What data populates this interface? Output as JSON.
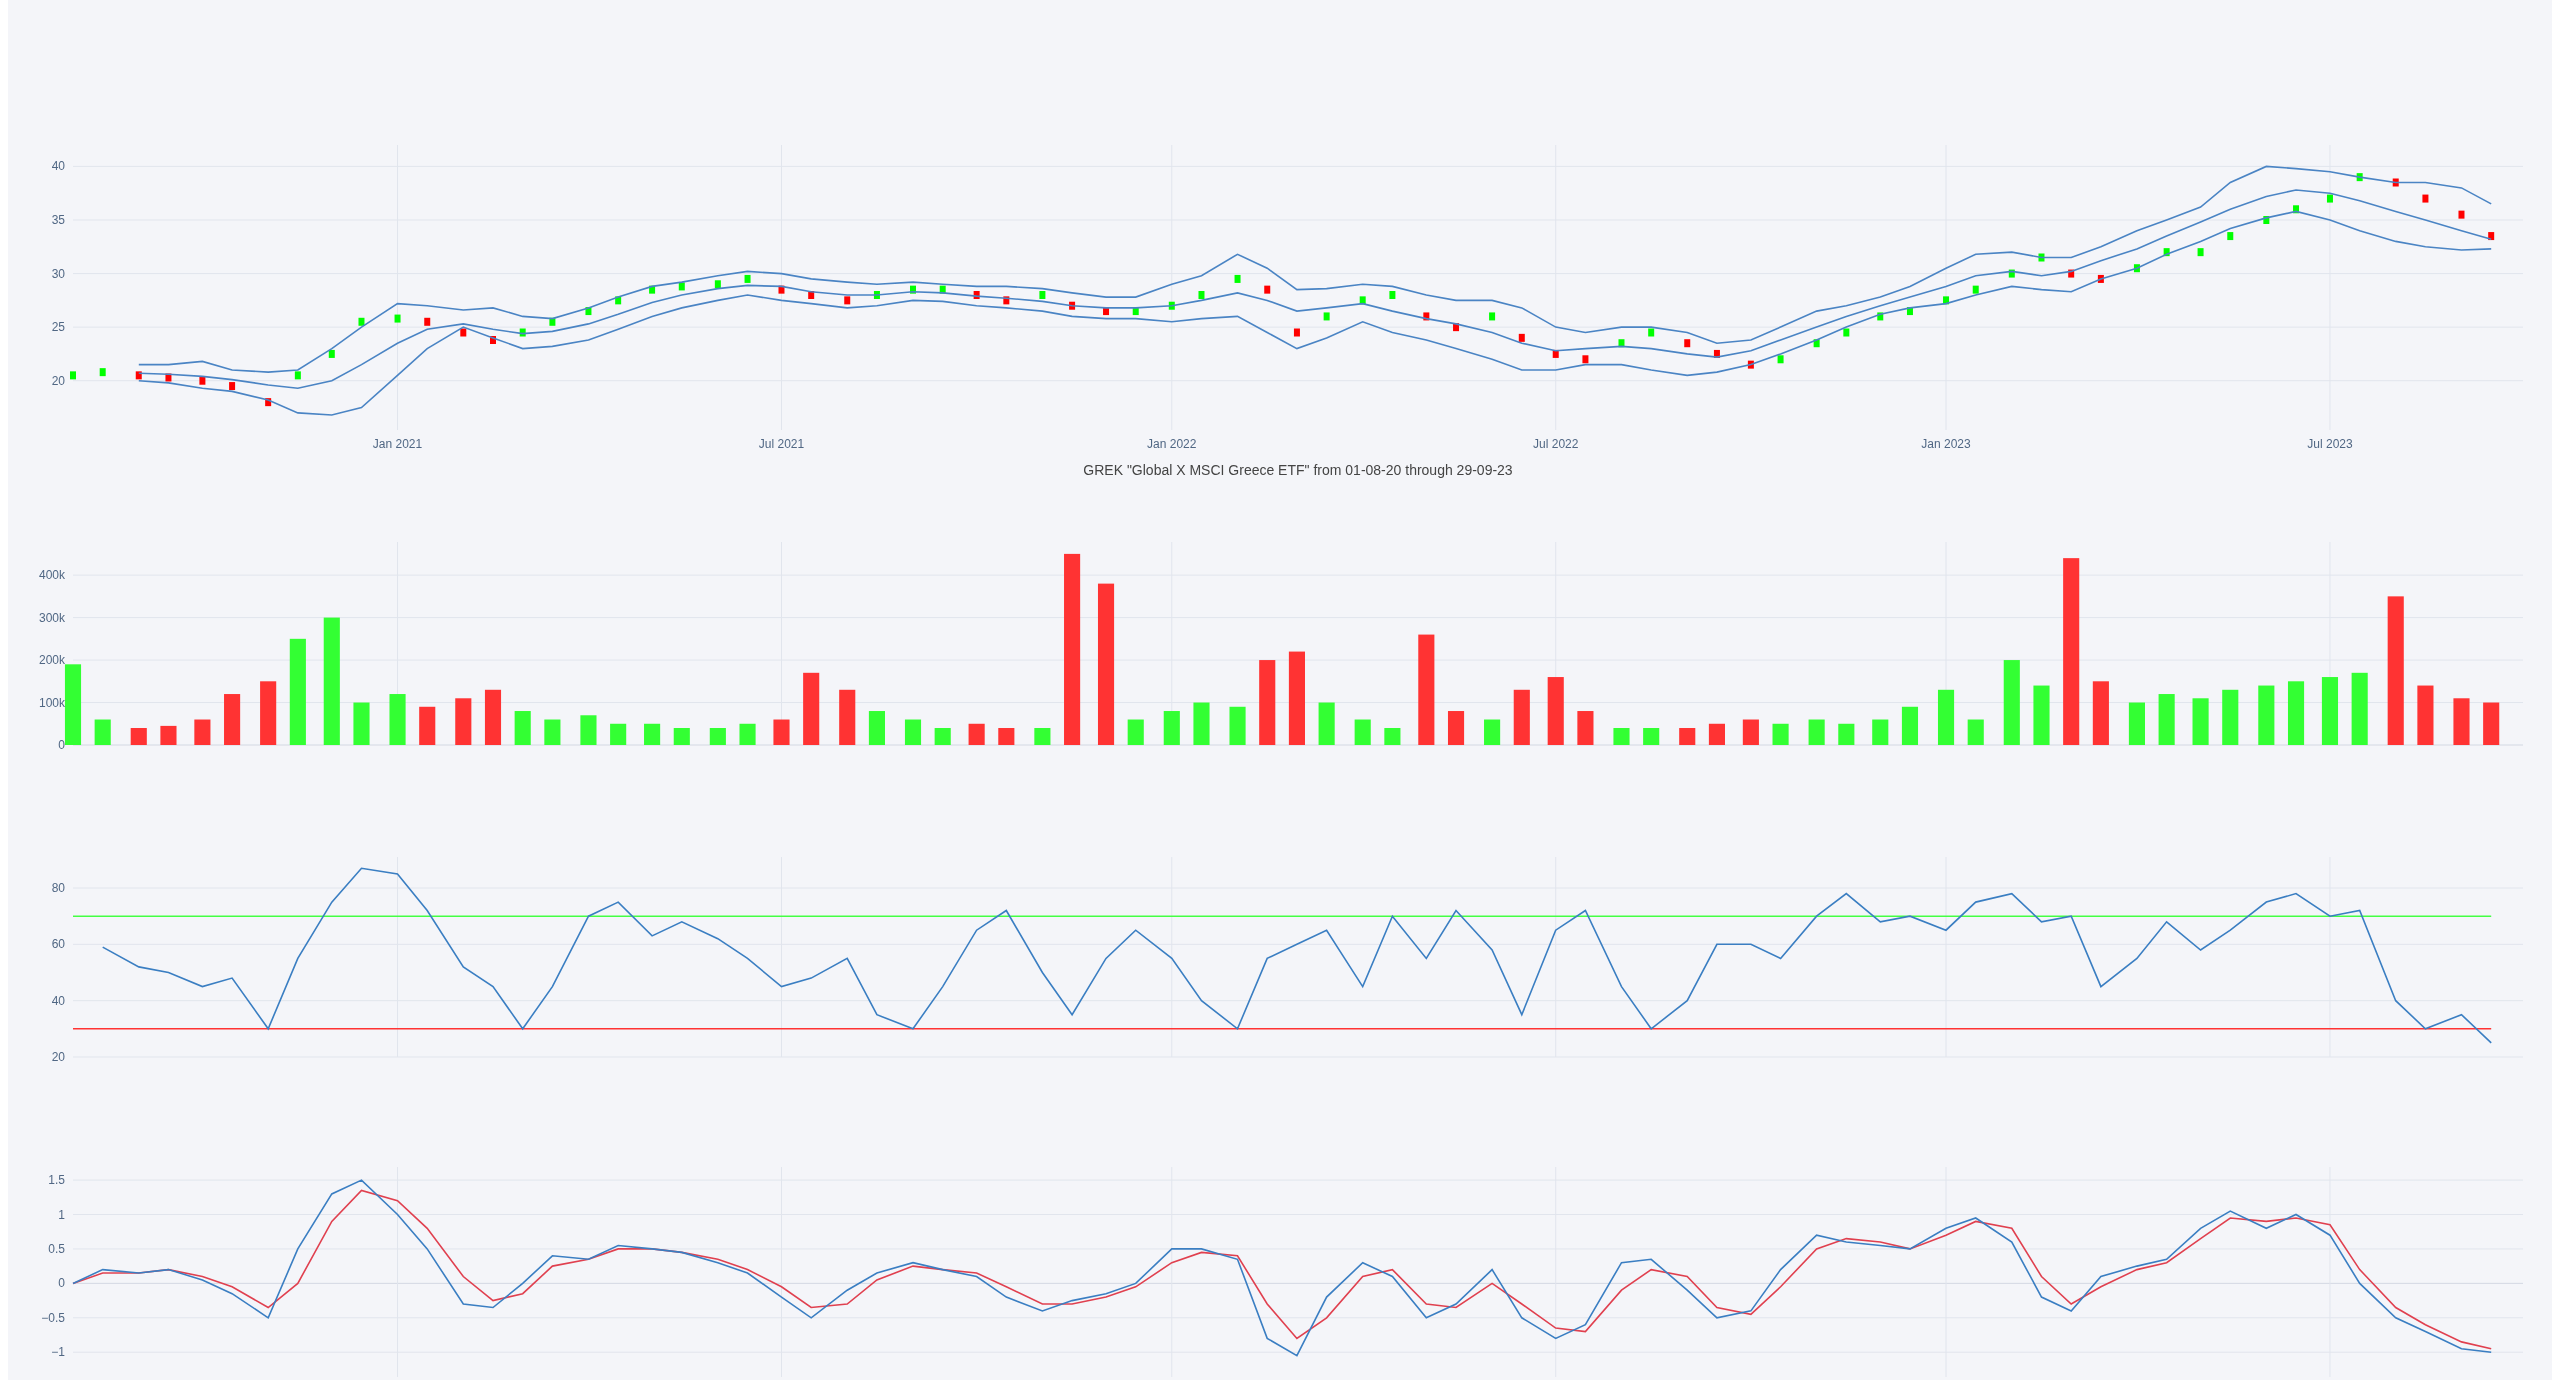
{
  "charts": [
    {
      "chart_data": {
        "type": "line",
        "grid": true,
        "x": [
          "2020-08-01",
          "2020-08-15",
          "2020-09-01",
          "2020-09-15",
          "2020-10-01",
          "2020-10-15",
          "2020-11-01",
          "2020-11-15",
          "2020-12-01",
          "2020-12-15",
          "2021-01-01",
          "2021-01-15",
          "2021-02-01",
          "2021-02-15",
          "2021-03-01",
          "2021-03-15",
          "2021-04-01",
          "2021-04-15",
          "2021-05-01",
          "2021-05-15",
          "2021-06-01",
          "2021-06-15",
          "2021-07-01",
          "2021-07-15",
          "2021-08-01",
          "2021-08-15",
          "2021-09-01",
          "2021-09-15",
          "2021-10-01",
          "2021-10-15",
          "2021-11-01",
          "2021-11-15",
          "2021-12-01",
          "2021-12-15",
          "2022-01-01",
          "2022-01-15",
          "2022-02-01",
          "2022-02-15",
          "2022-03-01",
          "2022-03-15",
          "2022-04-01",
          "2022-04-15",
          "2022-05-01",
          "2022-05-15",
          "2022-06-01",
          "2022-06-15",
          "2022-07-01",
          "2022-07-15",
          "2022-08-01",
          "2022-08-15",
          "2022-09-01",
          "2022-09-15",
          "2022-10-01",
          "2022-10-15",
          "2022-11-01",
          "2022-11-15",
          "2022-12-01",
          "2022-12-15",
          "2023-01-01",
          "2023-01-15",
          "2023-02-01",
          "2023-02-15",
          "2023-03-01",
          "2023-03-15",
          "2023-04-01",
          "2023-04-15",
          "2023-05-01",
          "2023-05-15",
          "2023-06-01",
          "2023-06-15",
          "2023-07-01",
          "2023-07-15",
          "2023-08-01",
          "2023-08-15",
          "2023-09-01",
          "2023-09-15"
        ],
        "series": [
          {
            "type": "scatter",
            "color": "#00ff00",
            "values": [
              20.5,
              20.8,
              null,
              null,
              null,
              null,
              null,
              20.5,
              22.5,
              25.5,
              25.8,
              null,
              null,
              null,
              24.5,
              25.5,
              26.5,
              27.5,
              28.5,
              28.8,
              29.0,
              29.5,
              null,
              null,
              null,
              28.0,
              28.5,
              28.5,
              null,
              null,
              28.0,
              null,
              null,
              26.5,
              27.0,
              28.0,
              29.5,
              null,
              null,
              26.0,
              27.5,
              28.0,
              null,
              null,
              26.0,
              null,
              null,
              null,
              23.5,
              24.5,
              null,
              null,
              null,
              22.0,
              23.5,
              24.5,
              26.0,
              26.5,
              27.5,
              28.5,
              30.0,
              31.5,
              null,
              null,
              30.5,
              32.0,
              32.0,
              33.5,
              35.0,
              36.0,
              37.0,
              39.0,
              null,
              null,
              null,
              null
            ]
          },
          {
            "type": "scatter",
            "color": "#ff0000",
            "values": [
              null,
              null,
              20.5,
              20.3,
              20.0,
              19.5,
              18.0,
              null,
              null,
              null,
              null,
              25.5,
              24.5,
              23.8,
              null,
              null,
              null,
              null,
              null,
              null,
              null,
              null,
              28.5,
              28.0,
              27.5,
              null,
              null,
              null,
              28.0,
              27.5,
              null,
              27.0,
              26.5,
              null,
              null,
              null,
              null,
              28.5,
              24.5,
              null,
              null,
              null,
              26.0,
              25.0,
              null,
              24.0,
              22.5,
              22.0,
              null,
              null,
              23.5,
              22.5,
              21.5,
              null,
              null,
              null,
              null,
              null,
              null,
              null,
              null,
              null,
              30.0,
              29.5,
              null,
              null,
              null,
              null,
              null,
              null,
              null,
              null,
              38.5,
              37.0,
              35.5,
              33.5
            ]
          },
          {
            "color": "#4a84c4",
            "values": [
              null,
              null,
              21.5,
              21.5,
              21.8,
              21.0,
              20.8,
              21.0,
              23.0,
              25.0,
              27.2,
              27.0,
              26.6,
              26.8,
              26.0,
              25.8,
              26.8,
              27.8,
              28.8,
              29.2,
              29.8,
              30.2,
              30.0,
              29.5,
              29.2,
              29.0,
              29.2,
              29.0,
              28.8,
              28.8,
              28.6,
              28.2,
              27.8,
              27.8,
              29.0,
              29.8,
              31.8,
              30.5,
              28.5,
              28.6,
              29.0,
              28.8,
              28.0,
              27.5,
              27.5,
              26.8,
              25.0,
              24.5,
              25.0,
              25.0,
              24.5,
              23.5,
              23.8,
              25.0,
              26.5,
              27.0,
              27.8,
              28.8,
              30.5,
              31.8,
              32.0,
              31.5,
              31.5,
              32.5,
              34.0,
              35.0,
              36.2,
              38.5,
              40.0,
              39.8,
              39.5,
              39.0,
              38.5,
              38.5,
              38.0,
              36.5
            ]
          },
          {
            "color": "#4a84c4",
            "values": [
              null,
              null,
              20.7,
              20.6,
              20.4,
              20.1,
              19.6,
              19.3,
              20.0,
              21.5,
              23.5,
              24.8,
              25.3,
              24.8,
              24.4,
              24.6,
              25.3,
              26.2,
              27.3,
              28.0,
              28.6,
              28.9,
              28.8,
              28.3,
              28.0,
              28.0,
              28.3,
              28.2,
              27.9,
              27.7,
              27.4,
              27.0,
              26.8,
              26.8,
              27.0,
              27.5,
              28.2,
              27.5,
              26.5,
              26.8,
              27.2,
              26.5,
              25.8,
              25.3,
              24.5,
              23.5,
              22.8,
              23.0,
              23.2,
              23.0,
              22.5,
              22.2,
              22.8,
              23.8,
              25.0,
              26.0,
              27.0,
              27.8,
              28.8,
              29.8,
              30.2,
              29.8,
              30.2,
              31.2,
              32.3,
              33.5,
              34.8,
              36.0,
              37.2,
              37.8,
              37.5,
              36.8,
              35.8,
              35.0,
              34.0,
              33.2
            ]
          },
          {
            "color": "#4a84c4",
            "values": [
              null,
              null,
              20.0,
              19.8,
              19.3,
              19.0,
              18.2,
              17.0,
              16.8,
              17.5,
              20.5,
              23.0,
              25.0,
              24.0,
              23.0,
              23.2,
              23.8,
              24.8,
              26.0,
              26.8,
              27.5,
              28.0,
              27.5,
              27.2,
              26.8,
              27.0,
              27.5,
              27.4,
              27.0,
              26.8,
              26.5,
              26.0,
              25.8,
              25.8,
              25.5,
              25.8,
              26.0,
              24.5,
              23.0,
              24.0,
              25.5,
              24.5,
              23.8,
              23.0,
              22.0,
              21.0,
              21.0,
              21.5,
              21.5,
              21.0,
              20.5,
              20.8,
              21.5,
              22.5,
              23.8,
              25.0,
              26.2,
              26.8,
              27.2,
              28.0,
              28.8,
              28.5,
              28.3,
              29.5,
              30.5,
              31.8,
              33.0,
              34.2,
              35.2,
              35.8,
              35.0,
              34.0,
              33.0,
              32.5,
              32.2,
              32.3
            ]
          }
        ],
        "xlim": [
          "2020-08-01",
          "2023-09-30"
        ],
        "ylim": [
          15.4,
          42
        ],
        "yticks": [
          {
            "value": 20,
            "label": "20"
          },
          {
            "value": 25,
            "label": "25"
          },
          {
            "value": 30,
            "label": "30"
          },
          {
            "value": 35,
            "label": "35"
          },
          {
            "value": 40,
            "label": "40"
          }
        ],
        "xticks": [
          {
            "value": "2021-01-01",
            "label": "Jan 2021"
          },
          {
            "value": "2021-07-01",
            "label": "Jul 2021"
          },
          {
            "value": "2022-01-01",
            "label": "Jan 2022"
          },
          {
            "value": "2022-07-01",
            "label": "Jul 2022"
          },
          {
            "value": "2023-01-01",
            "label": "Jan 2023"
          },
          {
            "value": "2023-07-01",
            "label": "Jul 2023"
          }
        ]
      }
    },
    {
      "chart_data": {
        "type": "bar",
        "grid": true,
        "title": "GREK \"Global X MSCI Greece ETF\" from 01-08-20 through 29-09-23",
        "x": [
          "2020-08-01",
          "2020-08-15",
          "2020-09-01",
          "2020-09-15",
          "2020-10-01",
          "2020-10-15",
          "2020-11-01",
          "2020-11-15",
          "2020-12-01",
          "2020-12-15",
          "2021-01-01",
          "2021-01-15",
          "2021-02-01",
          "2021-02-15",
          "2021-03-01",
          "2021-03-15",
          "2021-04-01",
          "2021-04-15",
          "2021-05-01",
          "2021-05-15",
          "2021-06-01",
          "2021-06-15",
          "2021-07-01",
          "2021-07-15",
          "2021-08-01",
          "2021-08-15",
          "2021-09-01",
          "2021-09-15",
          "2021-10-01",
          "2021-10-15",
          "2021-11-01",
          "2021-11-15",
          "2021-12-01",
          "2021-12-15",
          "2022-01-01",
          "2022-01-15",
          "2022-02-01",
          "2022-02-15",
          "2022-03-01",
          "2022-03-15",
          "2022-04-01",
          "2022-04-15",
          "2022-05-01",
          "2022-05-15",
          "2022-06-01",
          "2022-06-15",
          "2022-07-01",
          "2022-07-15",
          "2022-08-01",
          "2022-08-15",
          "2022-09-01",
          "2022-09-15",
          "2022-10-01",
          "2022-10-15",
          "2022-11-01",
          "2022-11-15",
          "2022-12-01",
          "2022-12-15",
          "2023-01-01",
          "2023-01-15",
          "2023-02-01",
          "2023-02-15",
          "2023-03-01",
          "2023-03-15",
          "2023-04-01",
          "2023-04-15",
          "2023-05-01",
          "2023-05-15",
          "2023-06-01",
          "2023-06-15",
          "2023-07-01",
          "2023-07-15",
          "2023-08-01",
          "2023-08-15",
          "2023-09-01",
          "2023-09-15"
        ],
        "series": [
          {
            "color": "#33ff33",
            "values": [
              190,
              60,
              null,
              null,
              null,
              null,
              null,
              250,
              300,
              100,
              120,
              null,
              null,
              null,
              80,
              60,
              70,
              50,
              50,
              40,
              40,
              50,
              null,
              null,
              null,
              80,
              60,
              40,
              null,
              null,
              40,
              null,
              null,
              60,
              80,
              100,
              90,
              null,
              null,
              100,
              60,
              40,
              null,
              null,
              60,
              null,
              null,
              null,
              40,
              40,
              null,
              null,
              null,
              50,
              60,
              50,
              60,
              90,
              130,
              60,
              200,
              140,
              null,
              null,
              100,
              120,
              110,
              130,
              140,
              150,
              160,
              170,
              null,
              null,
              null,
              null
            ]
          },
          {
            "color": "#ff3333",
            "values": [
              null,
              null,
              40,
              45,
              60,
              120,
              150,
              null,
              null,
              null,
              null,
              90,
              110,
              130,
              null,
              null,
              null,
              null,
              null,
              null,
              null,
              null,
              60,
              170,
              130,
              null,
              null,
              null,
              50,
              40,
              null,
              450,
              380,
              null,
              null,
              null,
              null,
              200,
              220,
              null,
              null,
              null,
              260,
              80,
              null,
              130,
              160,
              80,
              null,
              null,
              40,
              50,
              60,
              null,
              null,
              null,
              null,
              null,
              null,
              null,
              null,
              null,
              440,
              150,
              null,
              null,
              null,
              null,
              null,
              null,
              null,
              null,
              350,
              140,
              110,
              100
            ]
          }
        ],
        "xlim": [
          "2020-08-01",
          "2023-09-30"
        ],
        "ylim": [
          0,
          478
        ],
        "yticks": [
          {
            "value": 0,
            "label": "0"
          },
          {
            "value": 100,
            "label": "100k"
          },
          {
            "value": 200,
            "label": "200k"
          },
          {
            "value": 300,
            "label": "300k"
          },
          {
            "value": 400,
            "label": "400k"
          }
        ]
      }
    },
    {
      "chart_data": {
        "type": "line",
        "grid": true,
        "x": [
          "2020-08-01",
          "2020-08-15",
          "2020-09-01",
          "2020-09-15",
          "2020-10-01",
          "2020-10-15",
          "2020-11-01",
          "2020-11-15",
          "2020-12-01",
          "2020-12-15",
          "2021-01-01",
          "2021-01-15",
          "2021-02-01",
          "2021-02-15",
          "2021-03-01",
          "2021-03-15",
          "2021-04-01",
          "2021-04-15",
          "2021-05-01",
          "2021-05-15",
          "2021-06-01",
          "2021-06-15",
          "2021-07-01",
          "2021-07-15",
          "2021-08-01",
          "2021-08-15",
          "2021-09-01",
          "2021-09-15",
          "2021-10-01",
          "2021-10-15",
          "2021-11-01",
          "2021-11-15",
          "2021-12-01",
          "2021-12-15",
          "2022-01-01",
          "2022-01-15",
          "2022-02-01",
          "2022-02-15",
          "2022-03-01",
          "2022-03-15",
          "2022-04-01",
          "2022-04-15",
          "2022-05-01",
          "2022-05-15",
          "2022-06-01",
          "2022-06-15",
          "2022-07-01",
          "2022-07-15",
          "2022-08-01",
          "2022-08-15",
          "2022-09-01",
          "2022-09-15",
          "2022-10-01",
          "2022-10-15",
          "2022-11-01",
          "2022-11-15",
          "2022-12-01",
          "2022-12-15",
          "2023-01-01",
          "2023-01-15",
          "2023-02-01",
          "2023-02-15",
          "2023-03-01",
          "2023-03-15",
          "2023-04-01",
          "2023-04-15",
          "2023-05-01",
          "2023-05-15",
          "2023-06-01",
          "2023-06-15",
          "2023-07-01",
          "2023-07-15",
          "2023-08-01",
          "2023-08-15",
          "2023-09-01",
          "2023-09-15"
        ],
        "series": [
          {
            "color": "#44ff44",
            "values": [
              70,
              70,
              70,
              70,
              70,
              70,
              70,
              70,
              70,
              70,
              70,
              70,
              70,
              70,
              70,
              70,
              70,
              70,
              70,
              70,
              70,
              70,
              70,
              70,
              70,
              70,
              70,
              70,
              70,
              70,
              70,
              70,
              70,
              70,
              70,
              70,
              70,
              70,
              70,
              70,
              70,
              70,
              70,
              70,
              70,
              70,
              70,
              70,
              70,
              70,
              70,
              70,
              70,
              70,
              70,
              70,
              70,
              70,
              70,
              70,
              70,
              70,
              70,
              70,
              70,
              70,
              70,
              70,
              70,
              70,
              70,
              70,
              70,
              70,
              70,
              70
            ]
          },
          {
            "color": "#ff3333",
            "values": [
              30,
              30,
              30,
              30,
              30,
              30,
              30,
              30,
              30,
              30,
              30,
              30,
              30,
              30,
              30,
              30,
              30,
              30,
              30,
              30,
              30,
              30,
              30,
              30,
              30,
              30,
              30,
              30,
              30,
              30,
              30,
              30,
              30,
              30,
              30,
              30,
              30,
              30,
              30,
              30,
              30,
              30,
              30,
              30,
              30,
              30,
              30,
              30,
              30,
              30,
              30,
              30,
              30,
              30,
              30,
              30,
              30,
              30,
              30,
              30,
              30,
              30,
              30,
              30,
              30,
              30,
              30,
              30,
              30,
              30,
              30,
              30,
              30,
              30,
              30,
              30
            ]
          },
          {
            "color": "#3a7ec2",
            "values": [
              null,
              59,
              52,
              50,
              45,
              48,
              30,
              55,
              75,
              87,
              85,
              72,
              52,
              45,
              30,
              45,
              70,
              75,
              63,
              68,
              62,
              55,
              45,
              48,
              55,
              35,
              30,
              45,
              65,
              72,
              50,
              35,
              55,
              65,
              55,
              40,
              30,
              55,
              60,
              65,
              45,
              70,
              55,
              72,
              58,
              35,
              65,
              72,
              45,
              30,
              40,
              60,
              60,
              55,
              70,
              78,
              68,
              70,
              65,
              75,
              78,
              68,
              70,
              45,
              55,
              68,
              58,
              65,
              75,
              78,
              70,
              72,
              40,
              30,
              35,
              25
            ]
          }
        ],
        "xlim": [
          "2020-08-01",
          "2023-09-30"
        ],
        "ylim": [
          20,
          91
        ],
        "yticks": [
          {
            "value": 20,
            "label": "20"
          },
          {
            "value": 40,
            "label": "40"
          },
          {
            "value": 60,
            "label": "60"
          },
          {
            "value": 80,
            "label": "80"
          }
        ]
      }
    },
    {
      "chart_data": {
        "type": "line",
        "grid": true,
        "x": [
          "2020-08-01",
          "2020-08-15",
          "2020-09-01",
          "2020-09-15",
          "2020-10-01",
          "2020-10-15",
          "2020-11-01",
          "2020-11-15",
          "2020-12-01",
          "2020-12-15",
          "2021-01-01",
          "2021-01-15",
          "2021-02-01",
          "2021-02-15",
          "2021-03-01",
          "2021-03-15",
          "2021-04-01",
          "2021-04-15",
          "2021-05-01",
          "2021-05-15",
          "2021-06-01",
          "2021-06-15",
          "2021-07-01",
          "2021-07-15",
          "2021-08-01",
          "2021-08-15",
          "2021-09-01",
          "2021-09-15",
          "2021-10-01",
          "2021-10-15",
          "2021-11-01",
          "2021-11-15",
          "2021-12-01",
          "2021-12-15",
          "2022-01-01",
          "2022-01-15",
          "2022-02-01",
          "2022-02-15",
          "2022-03-01",
          "2022-03-15",
          "2022-04-01",
          "2022-04-15",
          "2022-05-01",
          "2022-05-15",
          "2022-06-01",
          "2022-06-15",
          "2022-07-01",
          "2022-07-15",
          "2022-08-01",
          "2022-08-15",
          "2022-09-01",
          "2022-09-15",
          "2022-10-01",
          "2022-10-15",
          "2022-11-01",
          "2022-11-15",
          "2022-12-01",
          "2022-12-15",
          "2023-01-01",
          "2023-01-15",
          "2023-02-01",
          "2023-02-15",
          "2023-03-01",
          "2023-03-15",
          "2023-04-01",
          "2023-04-15",
          "2023-05-01",
          "2023-05-15",
          "2023-06-01",
          "2023-06-15",
          "2023-07-01",
          "2023-07-15",
          "2023-08-01",
          "2023-08-15",
          "2023-09-01",
          "2023-09-15"
        ],
        "series": [
          {
            "color": "#e0404f",
            "values": [
              0,
              0.15,
              0.15,
              0.2,
              0.1,
              -0.05,
              -0.35,
              0.0,
              0.9,
              1.35,
              1.2,
              0.8,
              0.1,
              -0.25,
              -0.15,
              0.25,
              0.35,
              0.5,
              0.5,
              0.45,
              0.35,
              0.2,
              -0.05,
              -0.35,
              -0.3,
              0.05,
              0.25,
              0.2,
              0.15,
              -0.05,
              -0.3,
              -0.3,
              -0.2,
              -0.05,
              0.3,
              0.45,
              0.4,
              -0.3,
              -0.8,
              -0.5,
              0.1,
              0.2,
              -0.3,
              -0.35,
              0.0,
              -0.3,
              -0.65,
              -0.7,
              -0.1,
              0.2,
              0.1,
              -0.35,
              -0.45,
              -0.05,
              0.5,
              0.65,
              0.6,
              0.5,
              0.7,
              0.9,
              0.8,
              0.1,
              -0.3,
              -0.05,
              0.2,
              0.3,
              0.65,
              0.95,
              0.9,
              0.95,
              0.85,
              0.2,
              -0.35,
              -0.6,
              -0.85,
              -0.95
            ]
          },
          {
            "color": "#3a7ec2",
            "values": [
              0,
              0.2,
              0.15,
              0.2,
              0.05,
              -0.15,
              -0.5,
              0.5,
              1.3,
              1.5,
              1.0,
              0.5,
              -0.3,
              -0.35,
              0.0,
              0.4,
              0.35,
              0.55,
              0.5,
              0.45,
              0.3,
              0.15,
              -0.2,
              -0.5,
              -0.1,
              0.15,
              0.3,
              0.2,
              0.1,
              -0.2,
              -0.4,
              -0.25,
              -0.15,
              0.0,
              0.5,
              0.5,
              0.35,
              -0.8,
              -1.05,
              -0.2,
              0.3,
              0.1,
              -0.5,
              -0.3,
              0.2,
              -0.5,
              -0.8,
              -0.6,
              0.3,
              0.35,
              -0.1,
              -0.5,
              -0.4,
              0.2,
              0.7,
              0.6,
              0.55,
              0.5,
              0.8,
              0.95,
              0.6,
              -0.2,
              -0.4,
              0.1,
              0.25,
              0.35,
              0.8,
              1.05,
              0.8,
              1.0,
              0.7,
              0.0,
              -0.5,
              -0.7,
              -0.95,
              -1.0
            ]
          }
        ],
        "xlim": [
          "2020-08-01",
          "2023-09-30"
        ],
        "ylim": [
          -1.36,
          1.69
        ],
        "yticks": [
          {
            "value": -1,
            "label": "−1"
          },
          {
            "value": -0.5,
            "label": "−0.5"
          },
          {
            "value": 0,
            "label": "0"
          },
          {
            "value": 0.5,
            "label": "0.5"
          },
          {
            "value": 1,
            "label": "1"
          },
          {
            "value": 1.5,
            "label": "1.5"
          }
        ]
      }
    }
  ]
}
